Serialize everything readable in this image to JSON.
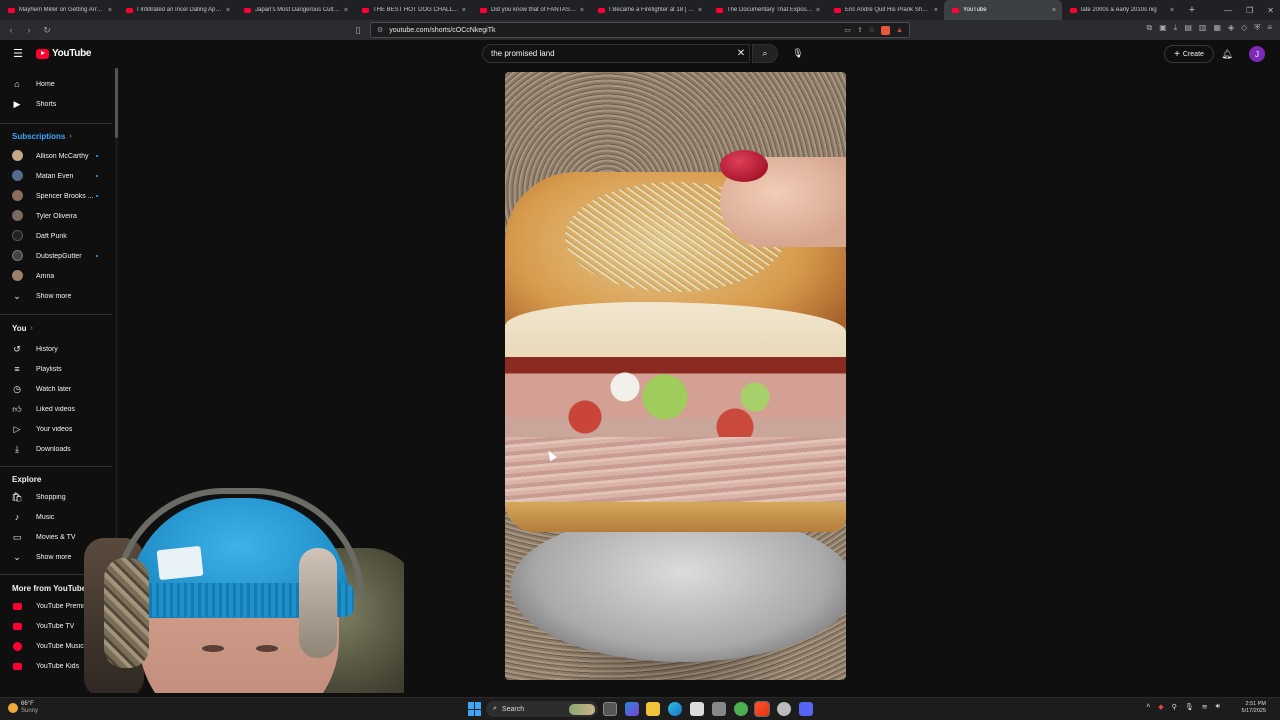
{
  "browser": {
    "tabs": [
      {
        "title": "Mayhem Miller on Getting Arreste",
        "active": false
      },
      {
        "title": "I Infiltrated an Incel Dating App - Y",
        "active": false
      },
      {
        "title": "Japan's Most Dangerous Cult, expl",
        "active": false
      },
      {
        "title": "THE BEST HOT DOG CHALLENGE !!",
        "active": false
      },
      {
        "title": "Did you know that of FANTASIA...",
        "active": false
      },
      {
        "title": "I Became a Firefighter at 18 | Wil",
        "active": false
      },
      {
        "title": "The Documentary That Exposed a",
        "active": false
      },
      {
        "title": "Eric Andre Quit His Prank Show O",
        "active": false
      },
      {
        "title": "YouTube",
        "active": true
      },
      {
        "title": "late 2000s & early 2010s nig",
        "active": false
      }
    ],
    "url": "youtube.com/shorts/cOCcNkegiTk"
  },
  "youtube": {
    "logo_text": "YouTube",
    "search_value": "the promised land",
    "create_label": "Create",
    "avatar_letter": "J"
  },
  "sidebar": {
    "top": [
      {
        "label": "Home",
        "icon": "home-icon"
      },
      {
        "label": "Shorts",
        "icon": "shorts-icon"
      }
    ],
    "subscriptions_heading": "Subscriptions",
    "subscriptions": [
      {
        "label": "Allison McCarthy",
        "new": true
      },
      {
        "label": "Matan Even",
        "new": true
      },
      {
        "label": "Spencer Brooks ...",
        "new": true
      },
      {
        "label": "Tyler Oliveira",
        "new": false
      },
      {
        "label": "Daft Punk",
        "new": false
      },
      {
        "label": "DubstepGutter",
        "new": true
      },
      {
        "label": "Amna",
        "new": false
      }
    ],
    "subs_show_more": "Show more",
    "you_heading": "You",
    "you": [
      {
        "label": "History",
        "icon": "history-icon"
      },
      {
        "label": "Playlists",
        "icon": "playlists-icon"
      },
      {
        "label": "Watch later",
        "icon": "watch-later-icon"
      },
      {
        "label": "Liked videos",
        "icon": "liked-videos-icon"
      },
      {
        "label": "Your videos",
        "icon": "your-videos-icon"
      },
      {
        "label": "Downloads",
        "icon": "downloads-icon"
      }
    ],
    "explore_heading": "Explore",
    "explore": [
      {
        "label": "Shopping",
        "icon": "shopping-icon"
      },
      {
        "label": "Music",
        "icon": "music-icon"
      },
      {
        "label": "Movies & TV",
        "icon": "movies-icon"
      }
    ],
    "explore_show_more": "Show more",
    "more_heading": "More from YouTube",
    "more": [
      {
        "label": "YouTube Premium"
      },
      {
        "label": "YouTube TV"
      },
      {
        "label": "YouTube Music"
      },
      {
        "label": "YouTube Kids"
      }
    ]
  },
  "taskbar": {
    "weather_temp": "66°F",
    "weather_desc": "Sunny",
    "search_label": "Search",
    "time": "2:51 PM",
    "date": "5/17/2025"
  },
  "colors": {
    "youtube_red": "#ff0033",
    "link_blue": "#3ea6ff",
    "background": "#0f0f0f"
  }
}
